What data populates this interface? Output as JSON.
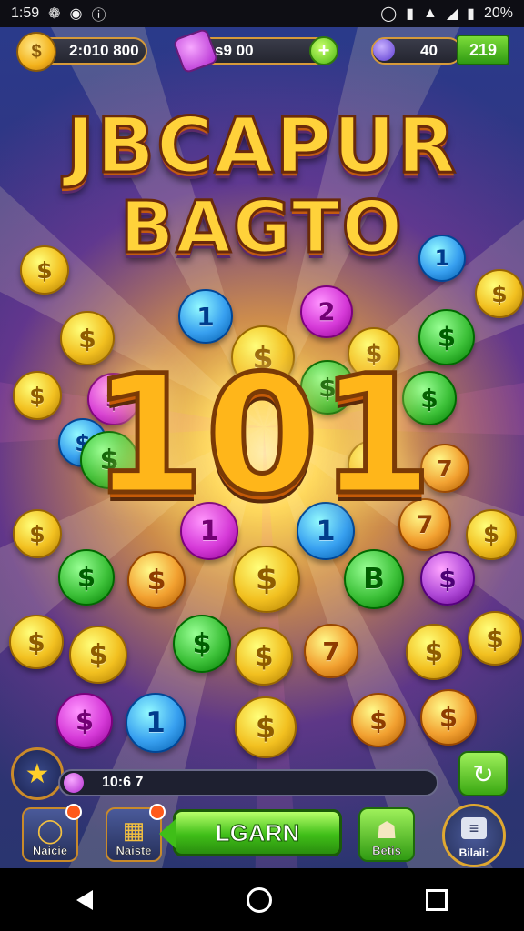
{
  "status_bar": {
    "time": "1:59",
    "battery_text": "20%"
  },
  "hud": {
    "coins": "2:010 800",
    "gems": "s9    00",
    "level": "40",
    "green_box": "219"
  },
  "title": {
    "line1": "JBCAPUR",
    "line2": "BAGTO"
  },
  "big_number": "101",
  "coins": [
    {
      "color": "#f2c020",
      "label": "$"
    },
    {
      "color": "#38a0f0",
      "label": "1"
    },
    {
      "color": "#d63ad8",
      "label": "2"
    },
    {
      "color": "#38a0f0",
      "label": "1"
    },
    {
      "color": "#f2c020",
      "label": "$"
    },
    {
      "color": "#f2c020",
      "label": "$"
    },
    {
      "color": "#f2c020",
      "label": "$"
    },
    {
      "color": "#3ec23a",
      "label": "$"
    },
    {
      "color": "#f2c020",
      "label": "$"
    },
    {
      "color": "#f2c020",
      "label": "$"
    },
    {
      "color": "#d63ad8",
      "label": "$"
    },
    {
      "color": "#3ec23a",
      "label": "$"
    },
    {
      "color": "#38a0f0",
      "label": "$"
    },
    {
      "color": "#3ec23a",
      "label": "$"
    },
    {
      "color": "#f2a030",
      "label": "7"
    },
    {
      "color": "#f2c020",
      "label": "$"
    },
    {
      "color": "#d63ad8",
      "label": "1"
    },
    {
      "color": "#38a0f0",
      "label": "1"
    },
    {
      "color": "#f2a030",
      "label": "7"
    },
    {
      "color": "#f2c020",
      "label": "$"
    },
    {
      "color": "#3ec23a",
      "label": "$"
    },
    {
      "color": "#f2a030",
      "label": "$"
    },
    {
      "color": "#f2c020",
      "label": "$"
    },
    {
      "color": "#3ec23a",
      "label": "B"
    },
    {
      "color": "#b04ad8",
      "label": "$"
    },
    {
      "color": "#f2c020",
      "label": "$"
    },
    {
      "color": "#f2c020",
      "label": "$"
    },
    {
      "color": "#3ec23a",
      "label": "$"
    },
    {
      "color": "#f2c020",
      "label": "$"
    },
    {
      "color": "#f2a030",
      "label": "7"
    },
    {
      "color": "#f2c020",
      "label": "$"
    },
    {
      "color": "#f2c020",
      "label": "$"
    },
    {
      "color": "#d63ad8",
      "label": "$"
    },
    {
      "color": "#38a0f0",
      "label": "1"
    },
    {
      "color": "#f2c020",
      "label": "$"
    },
    {
      "color": "#f2a030",
      "label": "$"
    },
    {
      "color": "#f2a030",
      "label": "$"
    },
    {
      "color": "#3ec23a",
      "label": "$"
    },
    {
      "color": "#f2c020",
      "label": "$"
    }
  ],
  "bottom": {
    "progress_text": "10:6 7",
    "learn_label": "LGARN",
    "btn1": "Naicie",
    "btn2": "Naiste",
    "btn3": "Betis",
    "btn4": "Bilail:"
  },
  "colors": {
    "accent_gold": "#ffb61a",
    "button_green": "#3fbe18"
  }
}
